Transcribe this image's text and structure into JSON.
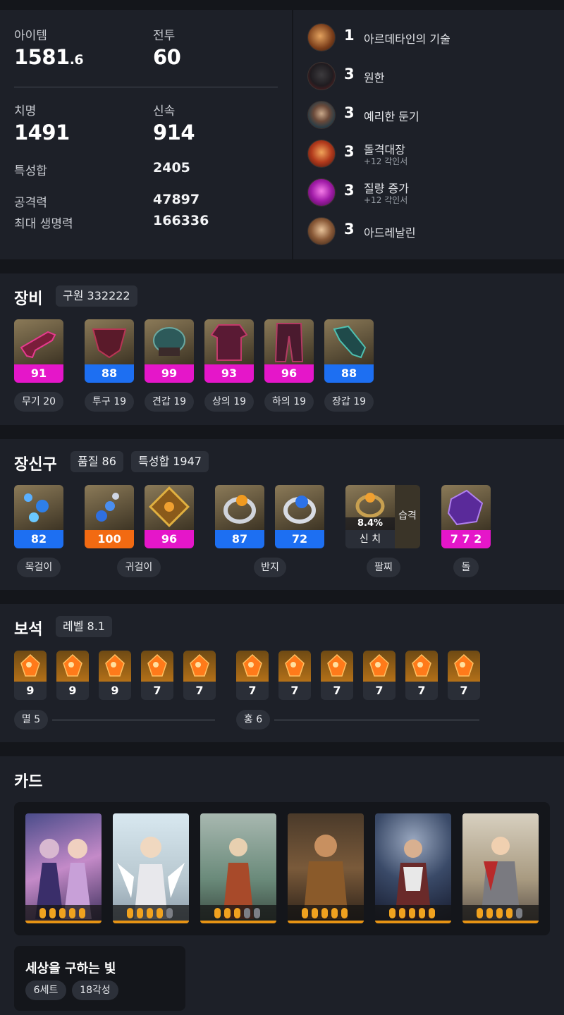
{
  "stats": {
    "item_level_label": "아이템",
    "item_level_int": "1581",
    "item_level_dec": ".6",
    "combat_label": "전투",
    "combat_value": "60",
    "crit_label": "치명",
    "crit_value": "1491",
    "swift_label": "신속",
    "swift_value": "914",
    "spec_sum_label": "특성합",
    "spec_sum_value": "2405",
    "attack_label": "공격력",
    "attack_value": "47897",
    "hp_label": "최대 생명력",
    "hp_value": "166336"
  },
  "engravings": [
    {
      "level": "1",
      "name": "아르데타인의 기술",
      "sub": "",
      "icon": "engraving-artisan-icon"
    },
    {
      "level": "3",
      "name": "원한",
      "sub": "",
      "icon": "engraving-grudge-icon"
    },
    {
      "level": "3",
      "name": "예리한 둔기",
      "sub": "",
      "icon": "engraving-keen-blunt-icon"
    },
    {
      "level": "3",
      "name": "돌격대장",
      "sub": "+12 각인서",
      "icon": "engraving-raid-captain-icon"
    },
    {
      "level": "3",
      "name": "질량 증가",
      "sub": "+12 각인서",
      "icon": "engraving-mass-increase-icon"
    },
    {
      "level": "3",
      "name": "아드레날린",
      "sub": "",
      "icon": "engraving-adrenaline-icon"
    }
  ],
  "equipment": {
    "title": "장비",
    "chip": "구원 332222",
    "items": [
      {
        "quality": "91",
        "color": "#e516c9",
        "label": "무기 20",
        "icon": "weapon-gun-icon"
      },
      {
        "quality": "88",
        "color": "#1d6ff2",
        "label": "투구 19",
        "icon": "helmet-icon"
      },
      {
        "quality": "99",
        "color": "#e516c9",
        "label": "견갑 19",
        "icon": "shoulder-icon"
      },
      {
        "quality": "93",
        "color": "#e516c9",
        "label": "상의 19",
        "icon": "chest-armor-icon"
      },
      {
        "quality": "96",
        "color": "#e516c9",
        "label": "하의 19",
        "icon": "pants-icon"
      },
      {
        "quality": "88",
        "color": "#1d6ff2",
        "label": "장갑 19",
        "icon": "gloves-icon"
      }
    ]
  },
  "accessories": {
    "title": "장신구",
    "chip_quality": "품질 86",
    "chip_spec": "특성합 1947",
    "items": [
      {
        "quality": "82",
        "color": "#1d6ff2",
        "icon": "necklace-icon"
      },
      {
        "quality": "100",
        "color": "#f26a12",
        "icon": "earring-icon"
      },
      {
        "quality": "96",
        "color": "#e516c9",
        "icon": "earring-icon"
      },
      {
        "quality": "87",
        "color": "#1d6ff2",
        "icon": "ring-icon"
      },
      {
        "quality": "72",
        "color": "#1d6ff2",
        "icon": "ring-icon"
      }
    ],
    "bracelet": {
      "percent": "8.4%",
      "stats": "신 치",
      "tag": "습격",
      "icon": "bracelet-icon"
    },
    "stone": {
      "value": "7 7 2",
      "color": "#e516c9",
      "icon": "ability-stone-icon"
    },
    "labels": {
      "necklace": "목걸이",
      "earring": "귀걸이",
      "ring": "반지",
      "bracelet": "팔찌",
      "stone": "돌"
    }
  },
  "gems": {
    "title": "보석",
    "chip": "레벨 8.1",
    "left": [
      "9",
      "9",
      "9",
      "7",
      "7"
    ],
    "right": [
      "7",
      "7",
      "7",
      "7",
      "7",
      "7"
    ],
    "left_label": "멸 5",
    "right_label": "홍 6"
  },
  "cards": {
    "title": "카드",
    "awakening": [
      5,
      4,
      3,
      5,
      5,
      4
    ],
    "set_name": "세상을 구하는 빛",
    "set_chip": "6세트",
    "awaken_chip": "18각성"
  }
}
